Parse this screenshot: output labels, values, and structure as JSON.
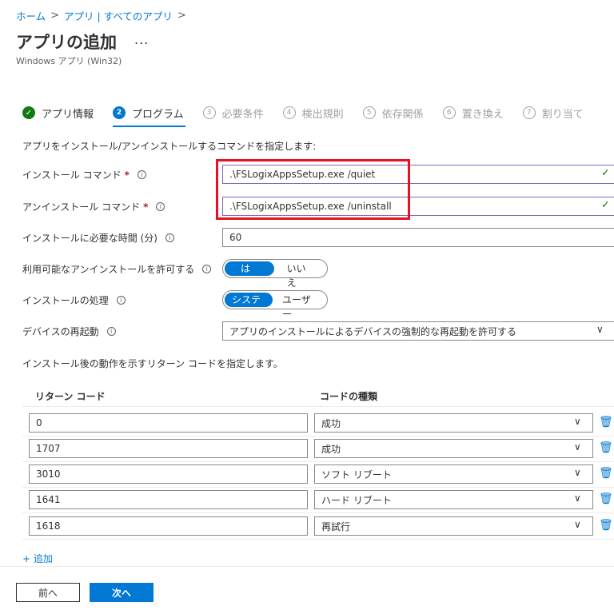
{
  "breadcrumb": {
    "home": "ホーム",
    "apps": "アプリ | すべてのアプリ",
    "sep": ">"
  },
  "header": {
    "title": "アプリの追加",
    "more": "...",
    "subtitle": "Windows アプリ (Win32)"
  },
  "steps": [
    {
      "num": "✓",
      "label": "アプリ情報",
      "state": "done"
    },
    {
      "num": "2",
      "label": "プログラム",
      "state": "active"
    },
    {
      "num": "3",
      "label": "必要条件",
      "state": "inactive"
    },
    {
      "num": "4",
      "label": "検出規則",
      "state": "inactive"
    },
    {
      "num": "5",
      "label": "依存関係",
      "state": "inactive"
    },
    {
      "num": "6",
      "label": "置き換え",
      "state": "inactive"
    },
    {
      "num": "7",
      "label": "割り当て",
      "state": "inactive"
    }
  ],
  "program": {
    "description": "アプリをインストール/アンインストールするコマンドを指定します:",
    "install_label": "インストール コマンド",
    "install_value": ".\\FSLogixAppsSetup.exe /quiet",
    "uninstall_label": "アンインストール コマンド",
    "uninstall_value": ".\\FSLogixAppsSetup.exe /uninstall",
    "required_mark": "*",
    "time_label": "インストールに必要な時間 (分)",
    "time_value": "60",
    "allow_uninstall_label": "利用可能なアンインストールを許可する",
    "allow_yes": "はい",
    "allow_no": "いいえ",
    "behavior_label": "インストールの処理",
    "behavior_system": "システム",
    "behavior_user": "ユーザー",
    "restart_label": "デバイスの再起動",
    "restart_value": "アプリのインストールによるデバイスの強制的な再起動を許可する",
    "info_icon": "i",
    "check_icon": "✓",
    "chevron_icon": "∨"
  },
  "return_codes": {
    "description": "インストール後の動作を示すリターン コードを指定します。",
    "col_code": "リターン コード",
    "col_type": "コードの種類",
    "rows": [
      {
        "code": "0",
        "type": "成功"
      },
      {
        "code": "1707",
        "type": "成功"
      },
      {
        "code": "3010",
        "type": "ソフト リブート"
      },
      {
        "code": "1641",
        "type": "ハード リブート"
      },
      {
        "code": "1618",
        "type": "再試行"
      }
    ],
    "add_label": "+ 追加"
  },
  "footer": {
    "prev": "前へ",
    "next": "次へ"
  },
  "colors": {
    "accent": "#0078d4",
    "success": "#107c10",
    "highlight": "#e81123"
  }
}
